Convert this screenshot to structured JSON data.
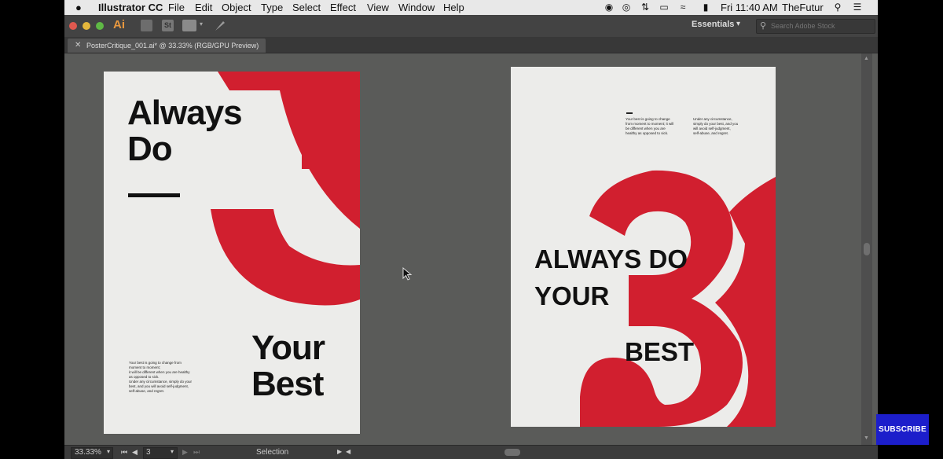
{
  "menubar": {
    "app_name": "Illustrator CC",
    "menus": [
      "File",
      "Edit",
      "Object",
      "Type",
      "Select",
      "Effect",
      "View",
      "Window",
      "Help"
    ],
    "clock": "Fri 11:40 AM",
    "user": "TheFutur"
  },
  "toolbar": {
    "app_logo": "Ai",
    "stock_icon": "St",
    "workspace": "Essentials",
    "search_placeholder": "Search Adobe Stock"
  },
  "document_tab": {
    "title": "PosterCritique_001.ai* @ 33.33% (RGB/GPU Preview)"
  },
  "artboard_left": {
    "headline": [
      "Always",
      "Do"
    ],
    "footer": [
      "Your",
      "Best"
    ],
    "body_lines": [
      "Your best is going to change from",
      "moment to moment;",
      "it will be different when you are healthy",
      "as opposed to sick.",
      "Under any circumstance, simply do your",
      "best, and you will avoid self-judgment,",
      "self-abuse, and regret."
    ],
    "accent_color": "#d11f2f"
  },
  "artboard_right": {
    "col1_lines": [
      "Your best is going to change",
      "from moment to moment; it will",
      "be different when you are",
      "healthy as opposed to sick."
    ],
    "col2_lines": [
      "Under any circumstance,",
      "simply do your best, and you",
      "will avoid self-judgment,",
      "self-abuse, and regret."
    ],
    "headline": "ALWAYS DO\nYOUR",
    "best": "BEST",
    "accent_color": "#d11f2f"
  },
  "statusbar": {
    "zoom": "33.33%",
    "artboard_number": "3",
    "tool": "Selection"
  },
  "subscribe_label": "SUBSCRIBE"
}
